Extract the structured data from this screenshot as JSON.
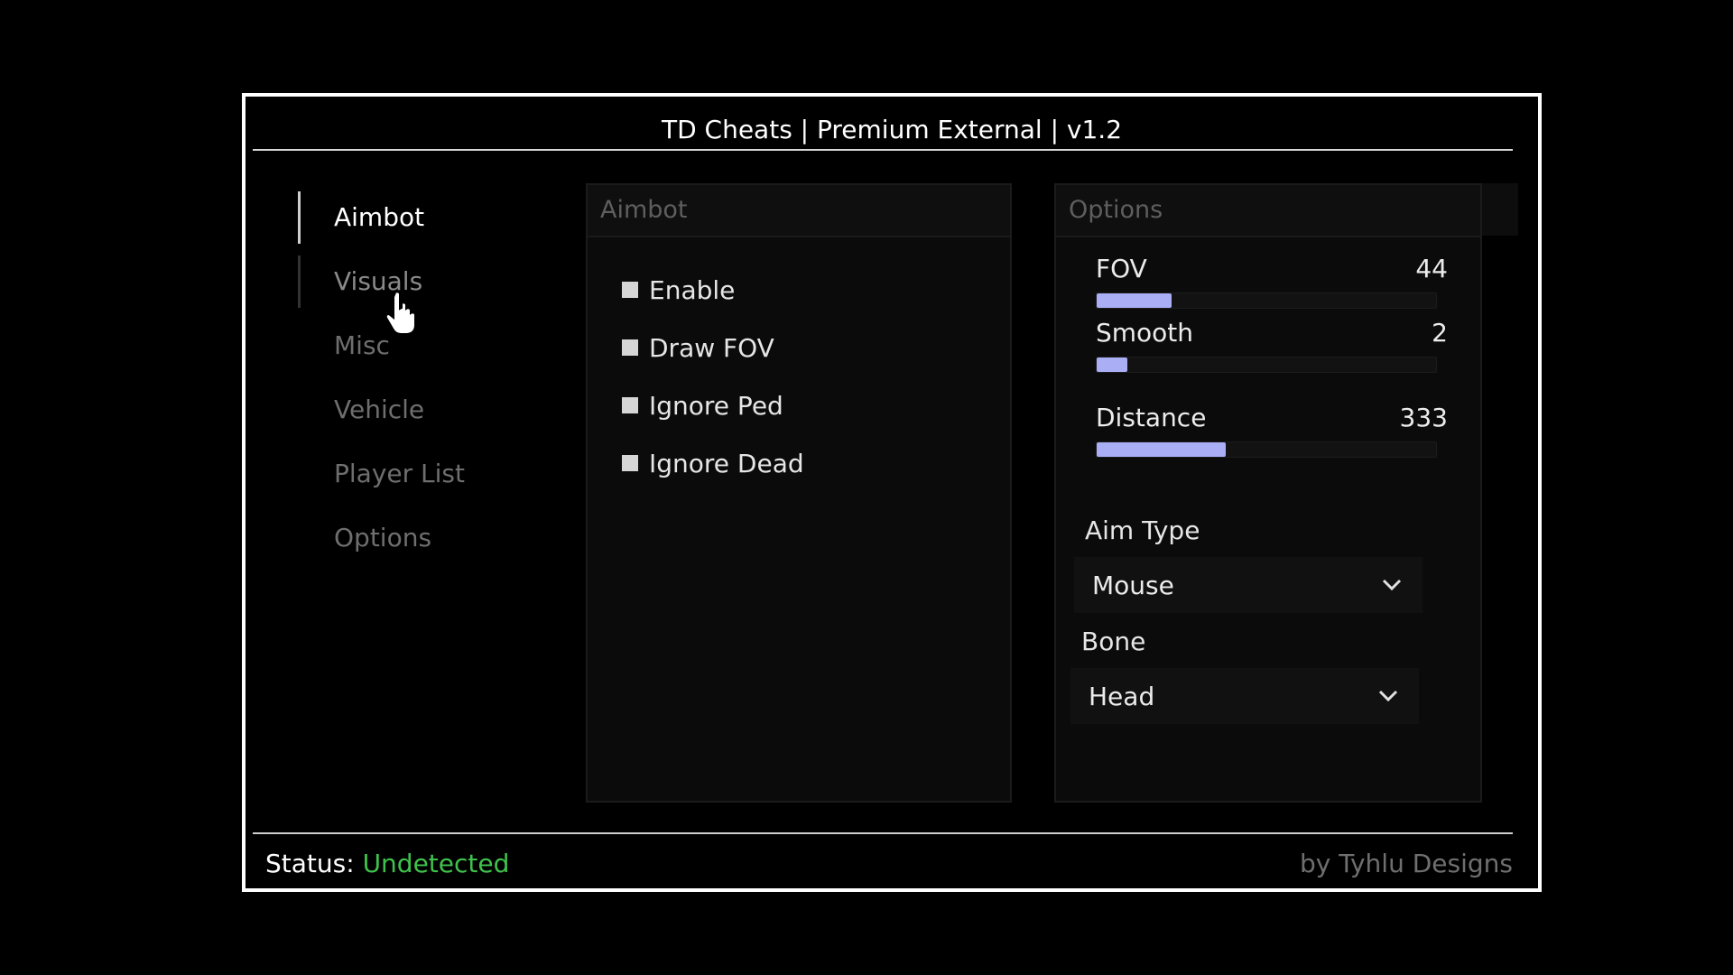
{
  "window": {
    "title": "TD Cheats | Premium External | v1.2"
  },
  "sidebar": {
    "items": [
      {
        "label": "Aimbot",
        "state": "active"
      },
      {
        "label": "Visuals",
        "state": "hover"
      },
      {
        "label": "Misc",
        "state": ""
      },
      {
        "label": "Vehicle",
        "state": ""
      },
      {
        "label": "Player List",
        "state": ""
      },
      {
        "label": "Options",
        "state": ""
      }
    ]
  },
  "aimbot_panel": {
    "header": "Aimbot",
    "checkboxes": [
      {
        "label": "Enable",
        "checked": false
      },
      {
        "label": "Draw FOV",
        "checked": false
      },
      {
        "label": "Ignore Ped",
        "checked": false
      },
      {
        "label": "Ignore Dead",
        "checked": false
      }
    ]
  },
  "options_panel": {
    "header": "Options",
    "sliders": [
      {
        "label": "FOV",
        "value": "44",
        "fill_fraction": 0.22
      },
      {
        "label": "Smooth",
        "value": "2",
        "fill_fraction": 0.09
      },
      {
        "label": "Distance",
        "value": "333",
        "fill_fraction": 0.38
      }
    ],
    "aim_type": {
      "label": "Aim Type",
      "selected": "Mouse"
    },
    "bone": {
      "label": "Bone",
      "selected": "Head"
    }
  },
  "footer": {
    "status_label": "Status:",
    "status_value": "Undetected",
    "credit": "by Tyhlu Designs"
  },
  "colors": {
    "accent": "#a9aef5",
    "status_ok": "#3fc24b",
    "window_border": "#ffffff"
  }
}
